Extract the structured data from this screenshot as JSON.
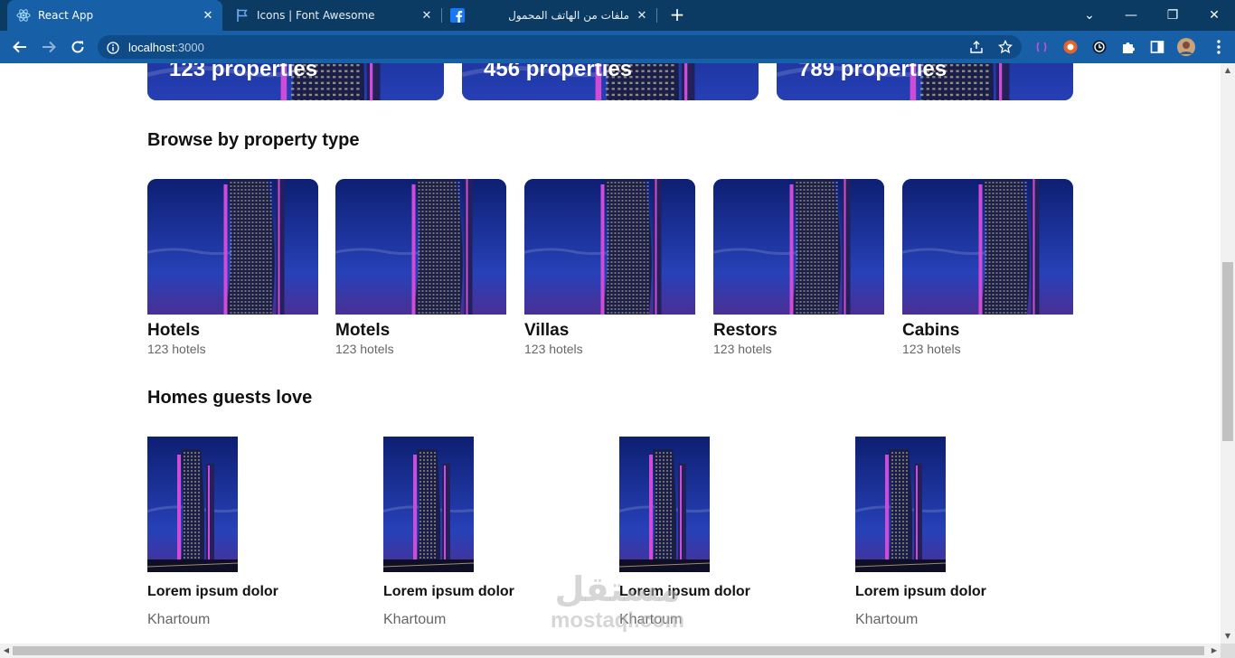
{
  "browser": {
    "tabs": [
      {
        "title": "React App",
        "icon": "react-icon",
        "active": true
      },
      {
        "title": "Icons | Font Awesome",
        "icon": "font-awesome-flag-icon",
        "active": false
      },
      {
        "title": "ملفات من الهاتف المحمول",
        "icon": "facebook-icon",
        "active": false
      }
    ],
    "tab_close_glyph": "✕",
    "new_tab_glyph": "+",
    "window_controls": {
      "dropdown": "⌄",
      "minimize": "—",
      "restore": "❐",
      "close": "✕"
    },
    "url_host": "localhost",
    "url_port": ":3000"
  },
  "featured": [
    {
      "text": "123 properties"
    },
    {
      "text": "456 properties"
    },
    {
      "text": "789 properties"
    }
  ],
  "property_types": {
    "title": "Browse by property type",
    "items": [
      {
        "name": "Hotels",
        "count": "123 hotels"
      },
      {
        "name": "Motels",
        "count": "123 hotels"
      },
      {
        "name": "Villas",
        "count": "123 hotels"
      },
      {
        "name": "Restors",
        "count": "123 hotels"
      },
      {
        "name": "Cabins",
        "count": "123 hotels"
      }
    ]
  },
  "homes": {
    "title": "Homes guests love",
    "items": [
      {
        "name": "Lorem ipsum dolor",
        "city": "Khartoum"
      },
      {
        "name": "Lorem ipsum dolor",
        "city": "Khartoum"
      },
      {
        "name": "Lorem ipsum dolor",
        "city": "Khartoum"
      },
      {
        "name": "Lorem ipsum dolor",
        "city": "Khartoum"
      }
    ]
  },
  "watermark": {
    "arabic": "مستقل",
    "latin": "mostaql.com"
  },
  "colors": {
    "tabbar": "#0b3a63",
    "toolbar": "#1760a8",
    "sky": "#1b34a8",
    "tower_accent": "#d04bd8"
  }
}
